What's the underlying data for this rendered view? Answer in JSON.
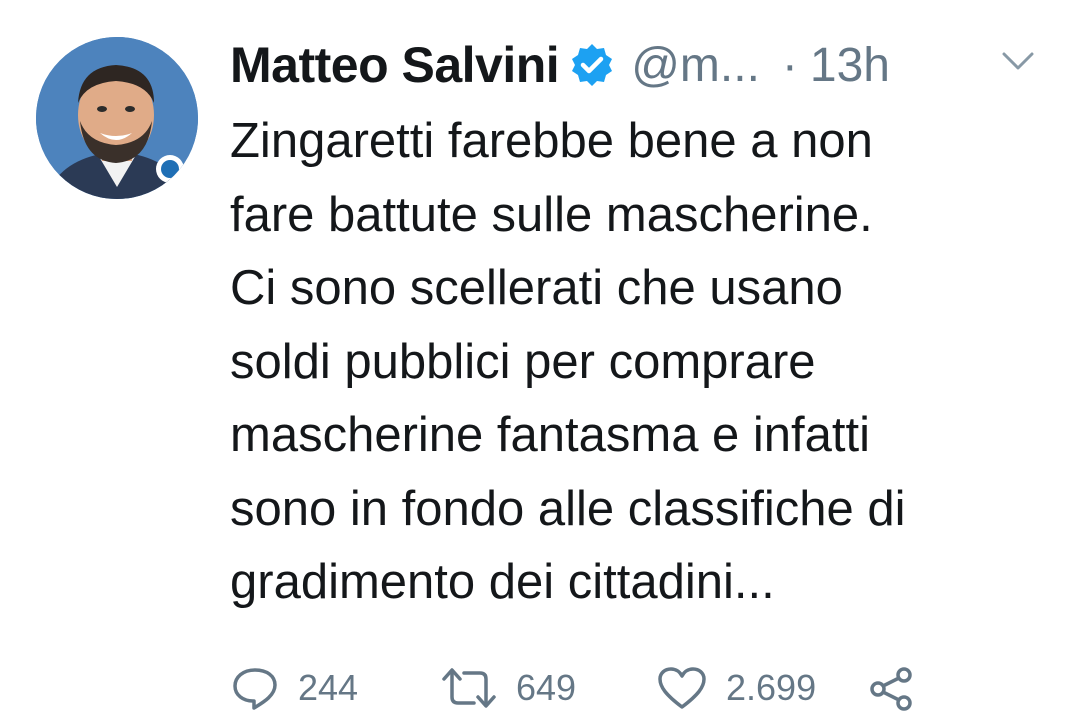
{
  "tweet": {
    "author": {
      "name": "Matteo Salvini",
      "handle": "@m...",
      "verified": true,
      "avatar_icon": "profile-photo"
    },
    "separator": "·",
    "time": "13h",
    "text_lines": [
      "Zingaretti farebbe bene a non",
      "fare battute sulle mascherine.",
      "Ci sono scellerati che usano",
      "soldi pubblici per comprare",
      "mascherine fantasma e infatti",
      "sono in fondo alle classifiche di",
      "gradimento dei cittadini..."
    ],
    "actions": {
      "reply_count": "244",
      "retweet_count": "649",
      "like_count": "2.699"
    }
  },
  "colors": {
    "text": "#14171a",
    "secondary": "#657786",
    "verified": "#1da1f2",
    "background": "#ffffff"
  }
}
